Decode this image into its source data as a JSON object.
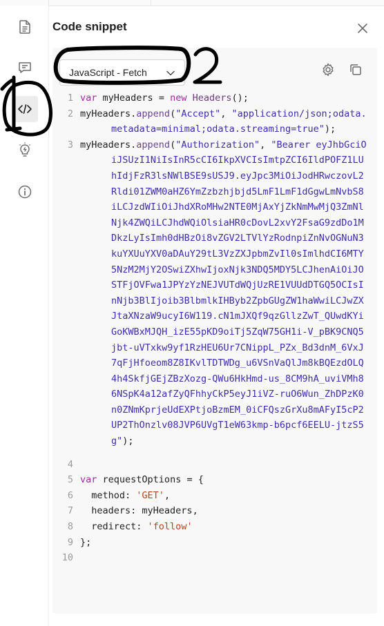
{
  "panel": {
    "title": "Code snippet",
    "language_select": {
      "value": "JavaScript - Fetch"
    }
  },
  "sidebar": {
    "items": [
      {
        "name": "documentation",
        "icon": "document-icon"
      },
      {
        "name": "comments",
        "icon": "comment-icon"
      },
      {
        "name": "code-snippet",
        "icon": "code-icon",
        "active": true
      },
      {
        "name": "insights",
        "icon": "lightbulb-icon"
      },
      {
        "name": "info",
        "icon": "info-icon"
      }
    ]
  },
  "annotations": {
    "label1": "1",
    "label2": "2"
  },
  "code": {
    "lines": [
      {
        "n": "1"
      },
      {
        "n": "2"
      },
      {
        "n": "3"
      },
      {
        "n": "4"
      },
      {
        "n": "5"
      },
      {
        "n": "6"
      },
      {
        "n": "7"
      },
      {
        "n": "8"
      },
      {
        "n": "9"
      },
      {
        "n": "10"
      }
    ],
    "tokens": {
      "l1_var": "var",
      "l1_name": "myHeaders",
      "l1_eq": " = ",
      "l1_new": "new",
      "l1_cls": "Headers",
      "l1_end": "();",
      "l2_obj": "myHeaders",
      "l2_dot": ".",
      "l2_fn": "append",
      "l2_open": "(",
      "l2_key": "\"Accept\"",
      "l2_comma": ", ",
      "l2_val": "\"application/json;odata.metadata=minimal;odata.streaming=true\"",
      "l2_end": ");",
      "l3_obj": "myHeaders",
      "l3_dot": ".",
      "l3_fn": "append",
      "l3_open": "(",
      "l3_key": "\"Authorization\"",
      "l3_comma": ", ",
      "l3_val": "\"Bearer eyJhbGciOiJSUzI1NiIsInR5cCI6IkpXVCIsImtpZCI6IldPOFZ1LUhIdjFzR3lsNWlBSE9sUSJ9.eyJpc3MiOiJodHRwczovL2Rldi01ZWM0aHZ6YmZzbzhjbjd5LmF1LmF1dGgwLmNvbS8iLCJzdWIiOiJhdXRoMHw2NTE0MjAxYjZkNmMwMjQ3ZmNlNjk4ZWQiLCJhdWQiOlsiaHR0cDovL2xvY2FsaG9zdDo1MDkzLyIsImh0dHBzOi8vZGV2LTVlYzRodnpiZnNvOGNuN3kuYXUuYXV0aDAuY29tL3VzZXJpbmZvIl0sImlhdCI6MTY5NzM2MjY2OSwiZXhwIjoxNjk3NDQ5MDY5LCJhenAiOiJOSTFjOVFwa1JPYzYzNEJVUTdWQjUzRE1VUUdDTGQ5OCIsInNjb3BlIjoib3BlbmlkIHByb2ZpbGUgZW1haWwiLCJwZXJtaXNzaW9ucyI6W119.cN1mJXQf9qzGllzZwT_QUwdKYiGoKWBxMJQH_izE55pKD9oiTj5ZqW75GH1i-V_pBK9CNQ5jbt-uVTxkw9yf1RzHEU6Ur7CNippL_PZx_Bd3dnM_6VxJ7qFjHfoeom8Z8IKvlTDTWDg_u6VSnVaQlJm8kBQEzdOLQ4h4SkfjGEjZBzXozg-QWu6HkHmd-us_8CM9hA_uviVMh86NSpK4a12afZyQFhhyCkP5eyJ1iVZ-ruO6Wun_ZhDPzK0n0ZNmKprjeUdEXPtjoBzmEM_0iCFQszGrXu8mAFyI5cP2UP2ThOnzlv08JVP6UVgT1eW63kmp-b6pcf6EELU-jtzS5g\"",
      "l3_end": ");",
      "l5_var": "var",
      "l5_name": "requestOptions",
      "l5_rest": " = {",
      "l6_key": "  method: ",
      "l6_val": "'GET'",
      "l6_end": ",",
      "l7_text": "  headers: myHeaders,",
      "l8_key": "  redirect: ",
      "l8_val": "'follow'",
      "l9_text": "};"
    }
  }
}
